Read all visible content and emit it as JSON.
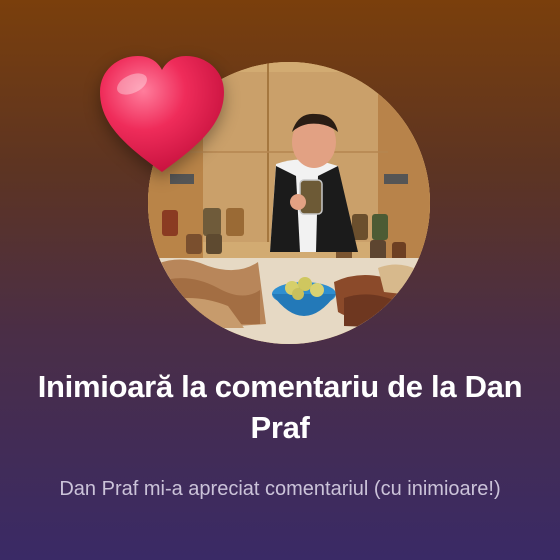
{
  "notification": {
    "title": "Inimioară la comentariu de la Dan Praf",
    "body": "Dan Praf mi-a apreciat comentariul (cu inimioare!)"
  },
  "icons": {
    "reaction": "heart-icon",
    "profile": "avatar"
  },
  "colors": {
    "background_top": "#7a3f0c",
    "background_bottom": "#3a2a66",
    "heart": "#e8204f",
    "title_text": "#ffffff",
    "body_text": "#cbc3d9"
  }
}
